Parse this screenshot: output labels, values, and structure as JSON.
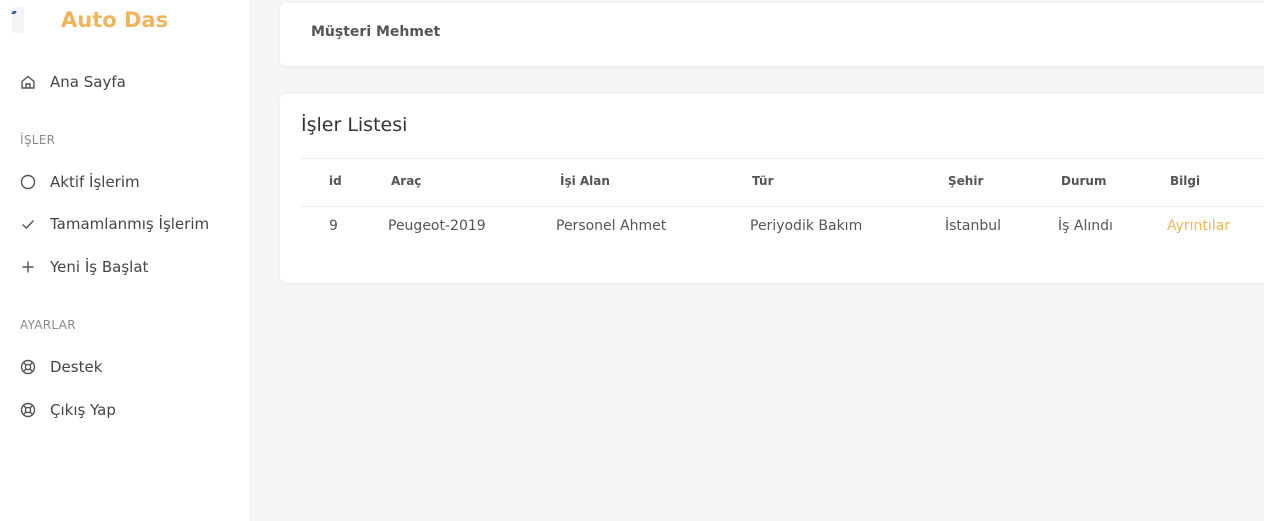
{
  "app": {
    "brand": "Auto Das"
  },
  "sidebar": {
    "home": "Ana Sayfa",
    "section_jobs": "İŞLER",
    "active_jobs": "Aktif İşlerim",
    "completed_jobs": "Tamamlanmış İşlerim",
    "new_job": "Yeni İş Başlat",
    "section_settings": "AYARLAR",
    "support": "Destek",
    "logout": "Çıkış Yap"
  },
  "header": {
    "user": "Müşteri Mehmet"
  },
  "jobs": {
    "title": "İşler Listesi",
    "columns": [
      "id",
      "Araç",
      "İşi Alan",
      "Tür",
      "Şehir",
      "Durum",
      "Bilgi"
    ],
    "rows": [
      [
        "9",
        "Peugeot-2019",
        "Personel Ahmet",
        "Periyodik Bakım",
        "İstanbul",
        "İş Alındı",
        "Ayrıntılar"
      ]
    ]
  },
  "colors": {
    "accent": "#f0b45a",
    "background": "#f5f5f5"
  }
}
